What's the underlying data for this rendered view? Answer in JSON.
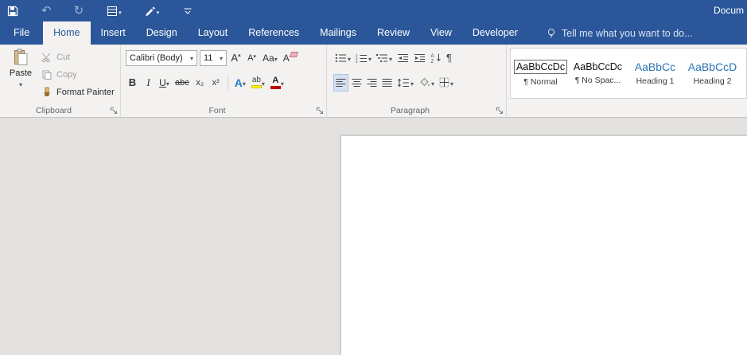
{
  "colors": {
    "titlebar_blue": "#2b579a",
    "active_tab_text": "#2b579a",
    "ribbon_bg": "#f3f2f1",
    "document_bg": "#e2e1e0",
    "heading_style_blue": "#2e74b5",
    "highlight_yellow": "#ffff00",
    "font_color_red": "#c00000",
    "selected_button_bg": "#d5e1f2"
  },
  "title_bar": {
    "document_title": "Docum"
  },
  "quick_access": {
    "undo_glyph": "↶",
    "redo_glyph": "↻"
  },
  "tabs": {
    "file": "File",
    "items": [
      {
        "label": "Home",
        "active": true
      },
      {
        "label": "Insert",
        "active": false
      },
      {
        "label": "Design",
        "active": false
      },
      {
        "label": "Layout",
        "active": false
      },
      {
        "label": "References",
        "active": false
      },
      {
        "label": "Mailings",
        "active": false
      },
      {
        "label": "Review",
        "active": false
      },
      {
        "label": "View",
        "active": false
      },
      {
        "label": "Developer",
        "active": false
      }
    ],
    "tell_me": "Tell me what you want to do..."
  },
  "ribbon": {
    "clipboard": {
      "label": "Clipboard",
      "paste_label": "Paste",
      "cut_label": "Cut",
      "copy_label": "Copy",
      "format_painter_label": "Format Painter"
    },
    "font": {
      "label": "Font",
      "font_name": "Calibri (Body)",
      "font_size": "11",
      "grow_font": "A",
      "shrink_font": "A",
      "change_case": "Aa",
      "clear_formatting": "A",
      "bold": "B",
      "italic": "I",
      "underline": "U",
      "strikethrough": "abc",
      "subscript": "x₂",
      "superscript": "x²",
      "text_effects": "A",
      "highlight": "ab",
      "font_color": "A"
    },
    "paragraph": {
      "label": "Paragraph",
      "show_hide_pilcrow": "¶",
      "sort_letters": [
        "A",
        "Z"
      ],
      "numbering_digits": [
        "1",
        "2",
        "3"
      ]
    },
    "styles": {
      "items": [
        {
          "preview": "AaBbCcDc",
          "name": "¶ Normal",
          "selected": true,
          "heading": false
        },
        {
          "preview": "AaBbCcDc",
          "name": "¶ No Spac...",
          "selected": false,
          "heading": false
        },
        {
          "preview": "AaBbCc",
          "name": "Heading 1",
          "selected": false,
          "heading": true
        },
        {
          "preview": "AaBbCcD",
          "name": "Heading 2",
          "selected": false,
          "heading": true
        }
      ]
    }
  }
}
